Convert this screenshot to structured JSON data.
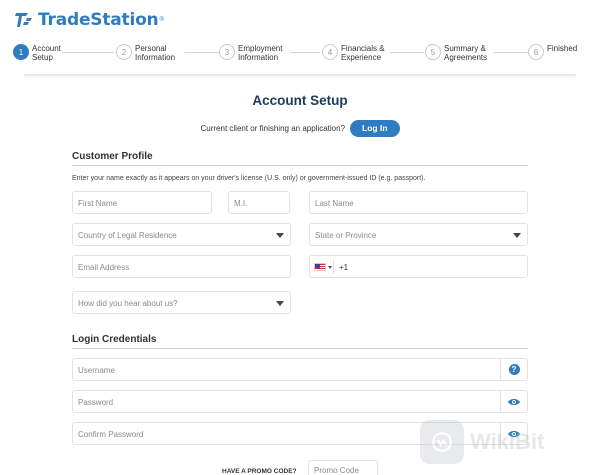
{
  "brand": {
    "name": "TradeStation",
    "tm": "®",
    "color": "#2f7cc0"
  },
  "steps": [
    {
      "num": "1",
      "label": "Account Setup",
      "active": true
    },
    {
      "num": "2",
      "label": "Personal Information",
      "active": false
    },
    {
      "num": "3",
      "label": "Employment Information",
      "active": false
    },
    {
      "num": "4",
      "label": "Financials & Experience",
      "active": false
    },
    {
      "num": "5",
      "label": "Summary & Agreements",
      "active": false
    },
    {
      "num": "6",
      "label": "Finished",
      "active": false
    }
  ],
  "page": {
    "title": "Account Setup",
    "login_question": "Current client or finishing an application?",
    "login_button": "Log In"
  },
  "customer_profile": {
    "heading": "Customer Profile",
    "hint": "Enter your name exactly as it appears on your driver's license (U.S. only) or government-issued ID (e.g. passport).",
    "first_name_placeholder": "First Name",
    "mi_placeholder": "M.I.",
    "last_name_placeholder": "Last Name",
    "country_placeholder": "Country of Legal Residence",
    "state_placeholder": "State or Province",
    "email_placeholder": "Email Address",
    "phone_code": "+1",
    "hear_placeholder": "How did you hear about us?"
  },
  "login_credentials": {
    "heading": "Login Credentials",
    "username_placeholder": "Username",
    "password_placeholder": "Password",
    "confirm_placeholder": "Confirm Password",
    "help_glyph": "?"
  },
  "promo": {
    "label": "HAVE A PROMO CODE?",
    "placeholder": "Promo Code"
  },
  "watermark": {
    "text": "WikiBit"
  }
}
